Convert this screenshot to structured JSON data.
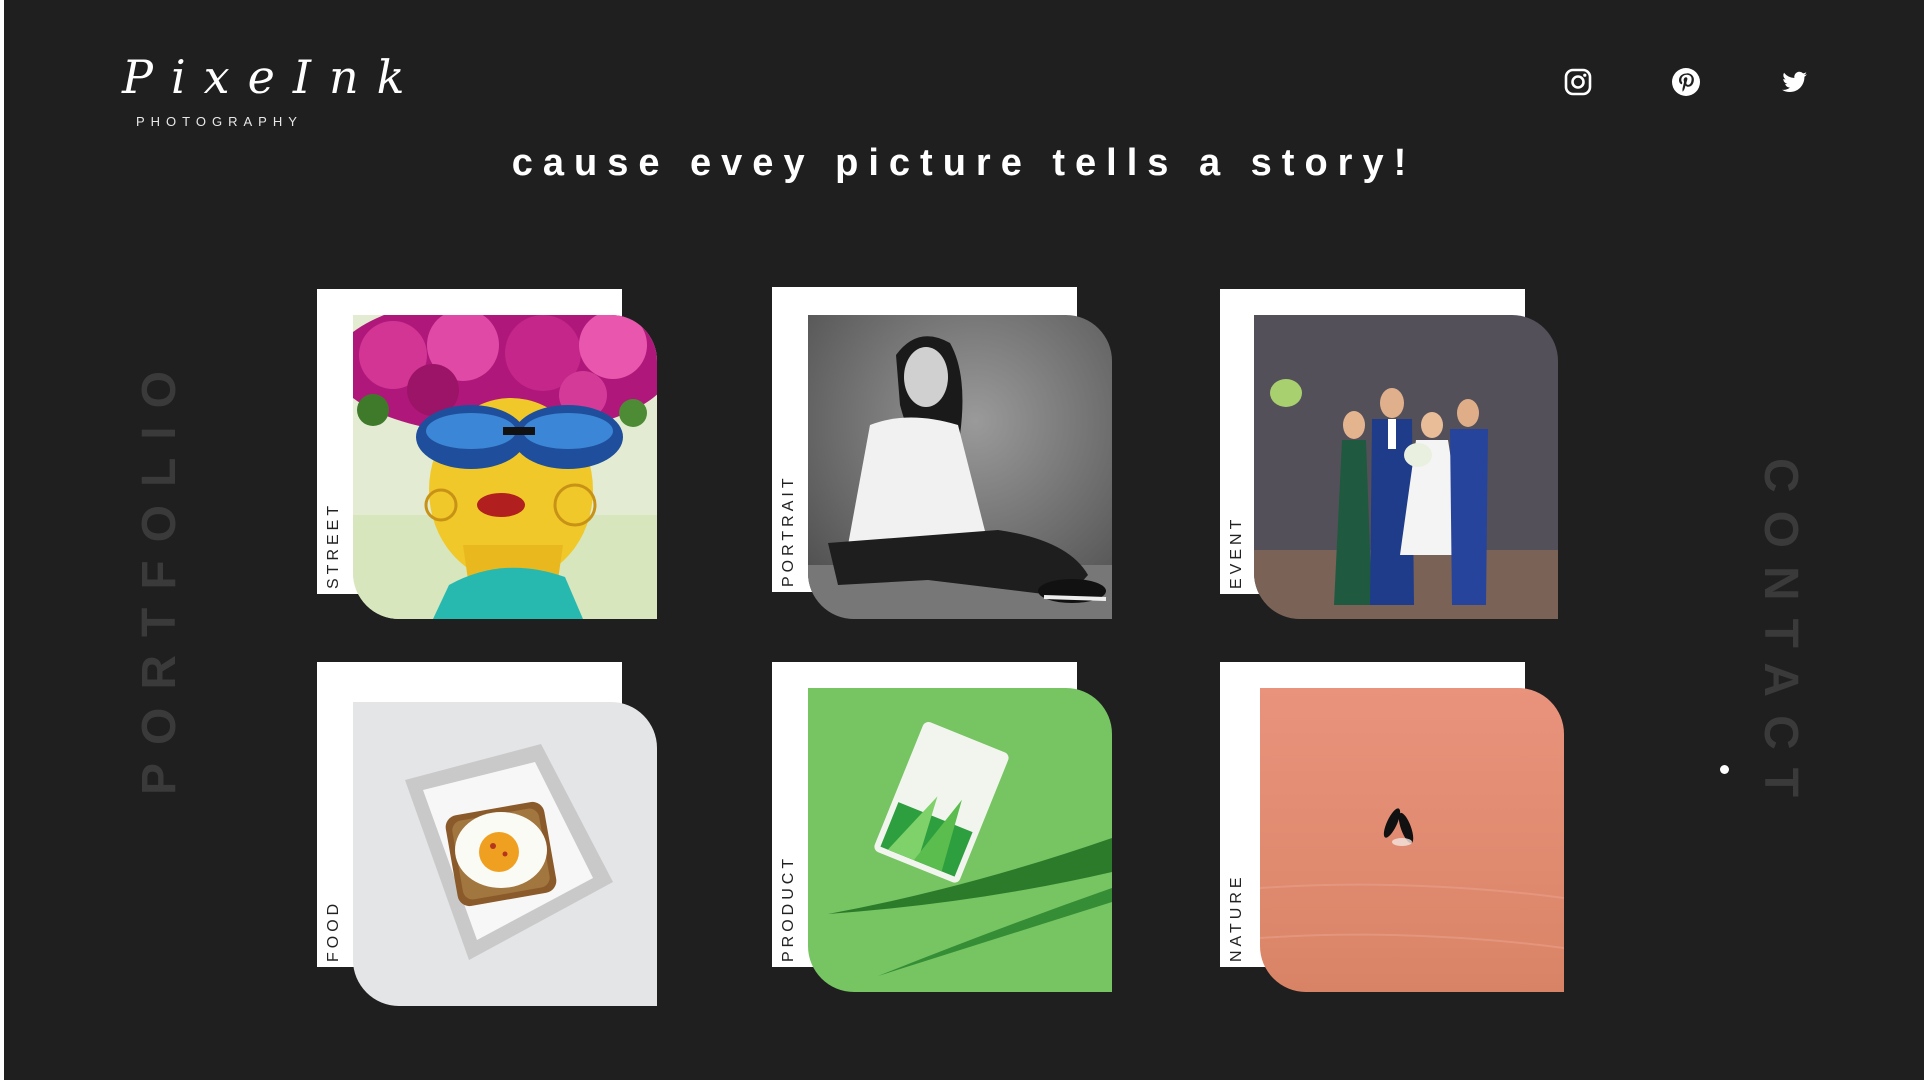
{
  "brand": {
    "name": "PixeInk",
    "subtitle": "PHOTOGRAPHY"
  },
  "social": [
    {
      "icon": "instagram-icon",
      "label": "Instagram"
    },
    {
      "icon": "pinterest-icon",
      "label": "Pinterest"
    },
    {
      "icon": "twitter-icon",
      "label": "Twitter"
    }
  ],
  "tagline": "cause evey picture tells a story!",
  "side": {
    "left": "PORTFOLIO",
    "right": "CONTACT"
  },
  "categories": [
    {
      "label": "STREET"
    },
    {
      "label": "PORTRAIT"
    },
    {
      "label": "EVENT"
    },
    {
      "label": "FOOD"
    },
    {
      "label": "PRODUCT"
    },
    {
      "label": "NATURE"
    }
  ],
  "colors": {
    "background": "#1f1f1f",
    "side_label": "#3a3a3a",
    "card_back": "#ffffff"
  }
}
